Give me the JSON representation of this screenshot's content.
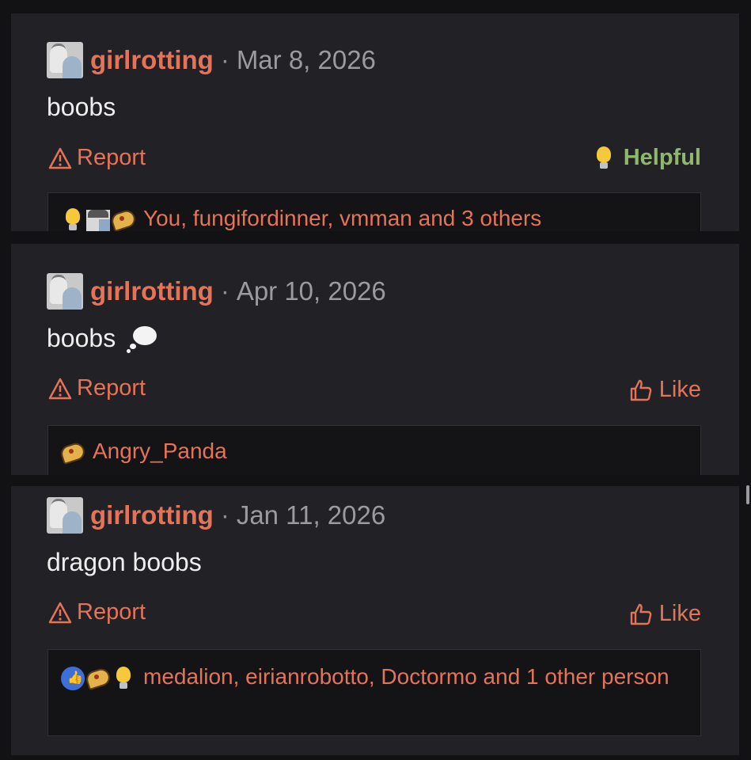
{
  "posts": [
    {
      "username": "girlrotting",
      "separator": "·",
      "date": "Mar 8, 2026",
      "body": "boobs",
      "report_label": "Report",
      "reaction_label": "Helpful",
      "reaction_type": "helpful",
      "reaction_icons": [
        "lightbulb-icon",
        "avatar-icon",
        "pizza-icon"
      ],
      "reactors": "You, fungifordinner, vmman and 3 others"
    },
    {
      "username": "girlrotting",
      "separator": "·",
      "date": "Apr 10, 2026",
      "body": "boobs",
      "report_label": "Report",
      "reaction_label": "Like",
      "reaction_type": "like",
      "reaction_icons": [
        "pizza-icon"
      ],
      "reactors": "Angry_Panda"
    },
    {
      "username": "girlrotting",
      "separator": "·",
      "date": "Jan 11, 2026",
      "body": "dragon boobs",
      "report_label": "Report",
      "reaction_label": "Like",
      "reaction_type": "like",
      "reaction_icons": [
        "thumbs-up-icon",
        "pizza-icon",
        "lightbulb-icon"
      ],
      "reactors": "medalion, eirianrobotto, Doctormo and 1 other person"
    }
  ],
  "colors": {
    "accent": "#e57357",
    "helpful": "#8fb86d",
    "post_bg": "#222226",
    "page_bg": "#121215"
  }
}
